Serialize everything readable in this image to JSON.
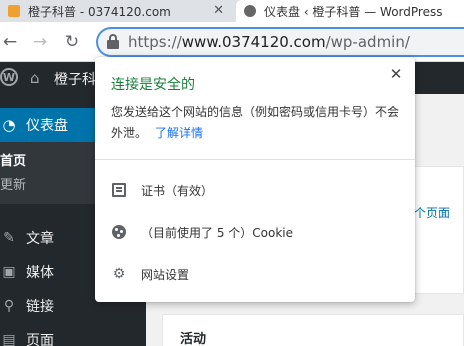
{
  "browser": {
    "tabs": [
      {
        "title": "橙子科普 - 0374120.com",
        "close_glyph": "✕",
        "active": false
      },
      {
        "title": "仪表盘 ‹ 橙子科普 — WordPress",
        "active": true
      }
    ],
    "nav": {
      "back_glyph": "←",
      "forward_glyph": "→",
      "reload_glyph": "↻"
    },
    "address": {
      "scheme": "https://",
      "host": "www.0374120.com",
      "path": "/wp-admin/",
      "icon": "lock-icon"
    }
  },
  "adminbar": {
    "logo_glyph": "W",
    "home_glyph": "⌂",
    "site_name": "橙子科普"
  },
  "sidebar": {
    "current": {
      "icon_glyph": "◔",
      "label": "仪表盘"
    },
    "submenu": [
      "首页",
      "更新"
    ],
    "items": [
      {
        "icon_glyph": "✎",
        "label": "文章"
      },
      {
        "icon_glyph": "▣",
        "label": "媒体"
      },
      {
        "icon_glyph": "⚲",
        "label": "链接"
      },
      {
        "icon_glyph": "▤",
        "label": "页面"
      }
    ]
  },
  "content": {
    "card_link": "个页面",
    "activity_title": "活动"
  },
  "popup": {
    "title": "连接是安全的",
    "close_glyph": "✕",
    "description": "您发送给这个网站的信息（例如密码或信用卡号）不会外泄。",
    "learn_more": "了解详情",
    "certificate": "证书（有效）",
    "cookies": "（目前使用了 5 个）Cookie",
    "site_settings_glyph": "⚙",
    "site_settings": "网站设置"
  },
  "colors": {
    "secure_green": "#188038",
    "link_blue": "#1a73e8",
    "wp_blue": "#0073aa",
    "wp_dark": "#23282d"
  }
}
